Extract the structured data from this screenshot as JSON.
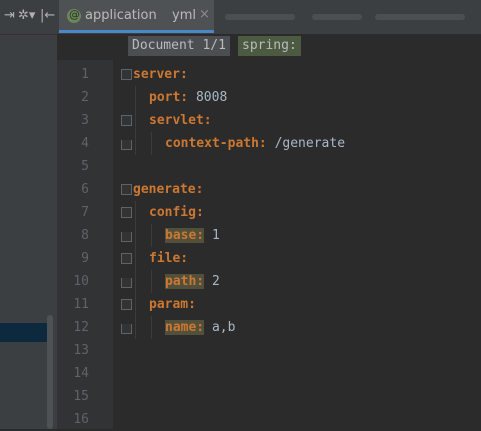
{
  "toolbar": {
    "icons": [
      "collapse-icon",
      "gear-icon",
      "hide-icon"
    ]
  },
  "tab": {
    "label": "application",
    "ext": "yml",
    "close": "×"
  },
  "breadcrumb": {
    "document": "Document 1/1",
    "path": "spring:"
  },
  "line_numbers": [
    "1",
    "2",
    "3",
    "4",
    "5",
    "6",
    "7",
    "8",
    "9",
    "10",
    "11",
    "12",
    "13",
    "14",
    "15",
    "16"
  ],
  "code": [
    {
      "key": "server:",
      "value": ""
    },
    {
      "key": "port:",
      "value": " 8008"
    },
    {
      "key": "servlet:",
      "value": ""
    },
    {
      "key": "context-path:",
      "value": " /generate"
    },
    {
      "key": "",
      "value": ""
    },
    {
      "key": "generate:",
      "value": ""
    },
    {
      "key": "config:",
      "value": ""
    },
    {
      "key": "base:",
      "value": " 1"
    },
    {
      "key": "file:",
      "value": ""
    },
    {
      "key": "path:",
      "value": " 2"
    },
    {
      "key": "param:",
      "value": ""
    },
    {
      "key": "name:",
      "value": " a,b"
    },
    {
      "key": "",
      "value": ""
    },
    {
      "key": "",
      "value": ""
    },
    {
      "key": "",
      "value": ""
    },
    {
      "key": "",
      "value": ""
    }
  ]
}
